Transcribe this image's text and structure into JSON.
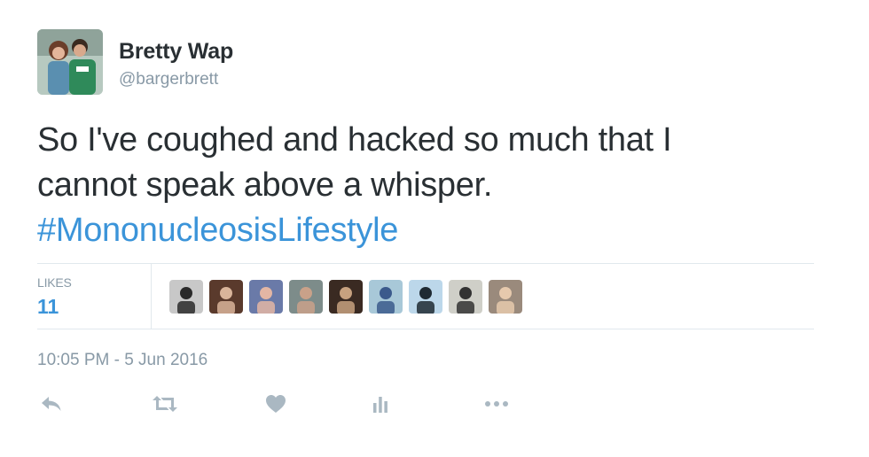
{
  "author": {
    "display_name": "Bretty Wap",
    "handle": "@bargerbrett"
  },
  "tweet": {
    "text_line1": "So I've coughed and hacked so much that I",
    "text_line2": "cannot speak above a whisper.",
    "hashtag": "#MononucleosisLifestyle"
  },
  "stats": {
    "likes_label": "LIKES",
    "likes_count": "11"
  },
  "likers": [
    {
      "name": "liker-1",
      "bg": "#c8c8c8",
      "fg": "#2a2a2a"
    },
    {
      "name": "liker-2",
      "bg": "#5a3a2c",
      "fg": "#d9b49a"
    },
    {
      "name": "liker-3",
      "bg": "#6a7aa8",
      "fg": "#e3b6a4"
    },
    {
      "name": "liker-4",
      "bg": "#7d8c8a",
      "fg": "#c9a189"
    },
    {
      "name": "liker-5",
      "bg": "#3a2a22",
      "fg": "#c7a17f"
    },
    {
      "name": "liker-6",
      "bg": "#a8c8d8",
      "fg": "#3b5a8c"
    },
    {
      "name": "liker-7",
      "bg": "#bcd7ea",
      "fg": "#1f2a33"
    },
    {
      "name": "liker-8",
      "bg": "#cfcfc8",
      "fg": "#333333"
    },
    {
      "name": "liker-9",
      "bg": "#9a8a7c",
      "fg": "#e6c9ad"
    }
  ],
  "timestamp": "10:05 PM - 5 Jun 2016",
  "actions": {
    "reply_icon": "reply-icon",
    "retweet_icon": "retweet-icon",
    "like_icon": "heart-icon",
    "analytics_icon": "analytics-icon",
    "more_icon": "more-icon"
  },
  "colors": {
    "link": "#3b94d9",
    "muted": "#8899a6",
    "text": "#292f33",
    "icon": "#aab8c2",
    "divider": "#e1e8ed"
  }
}
